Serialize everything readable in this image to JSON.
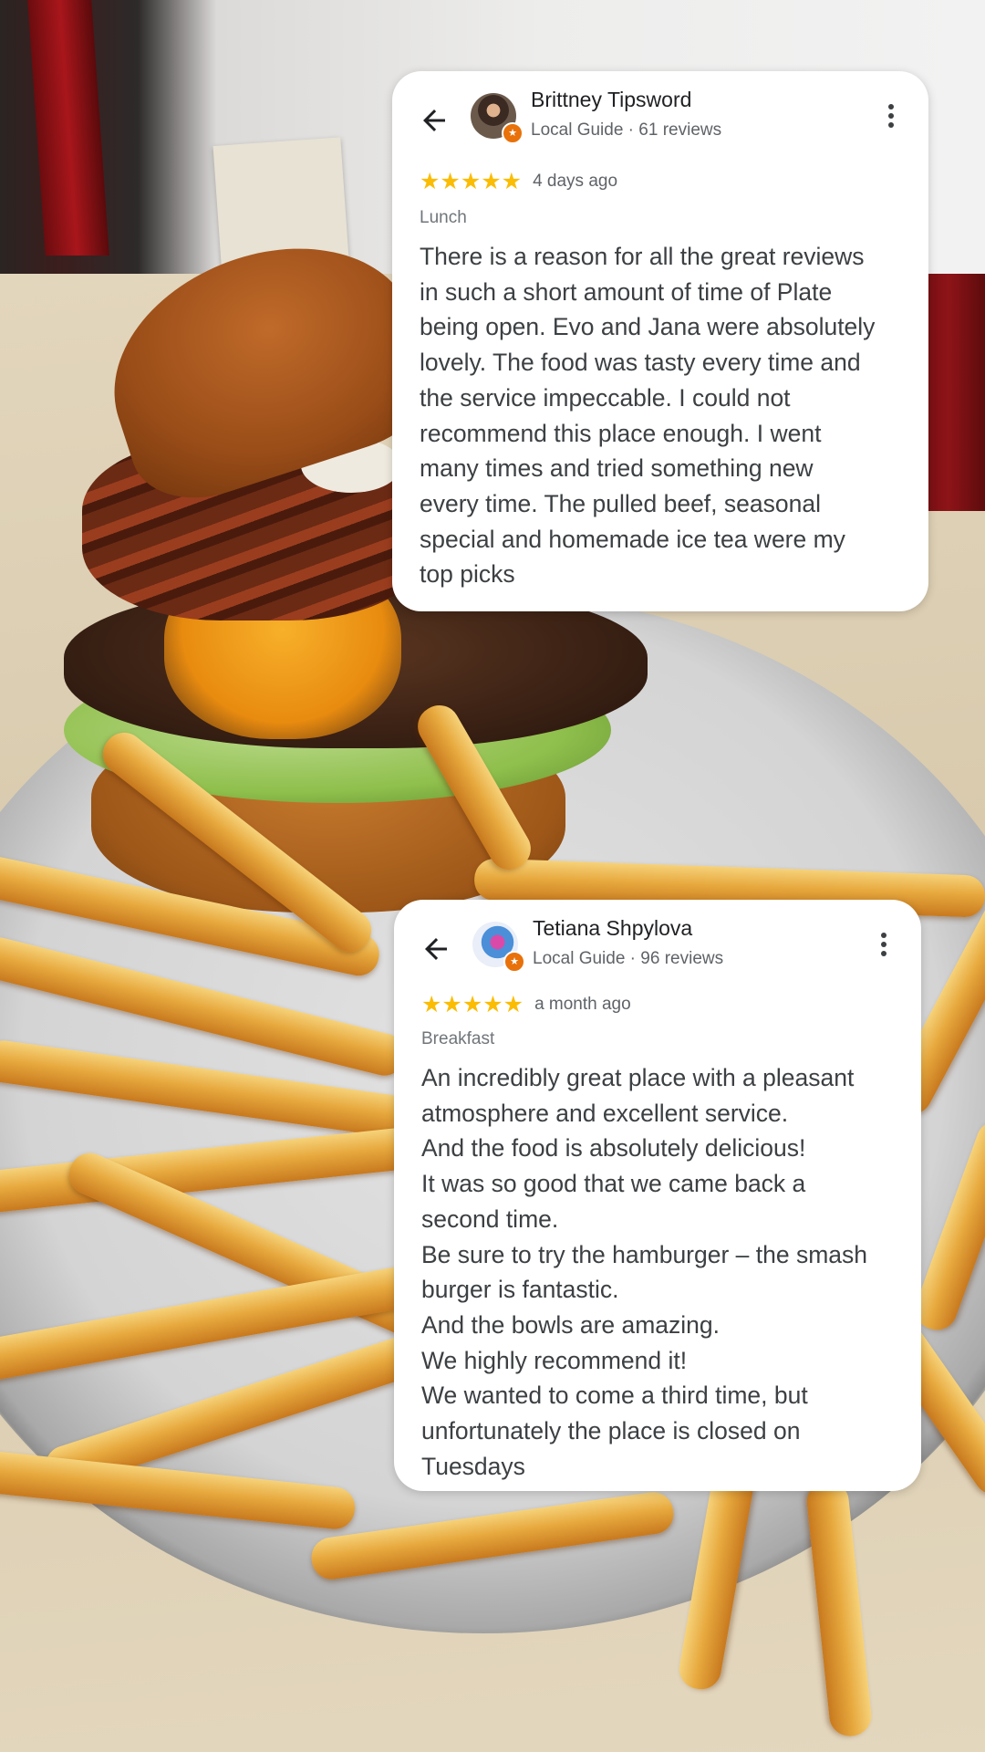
{
  "reviews": [
    {
      "name": "Brittney Tipsword",
      "meta": "Local Guide · 61 reviews",
      "stars": "★★★★★",
      "rating": 5,
      "time": "4 days ago",
      "meal": "Lunch",
      "text_lines": [
        "There is a reason for all the great reviews",
        "in such a short amount of time of Plate",
        "being open. Evo and Jana were absolutely",
        "lovely. The food was tasty every time and",
        "the service impeccable. I could not",
        "recommend this place enough. I went",
        "many times and tried something new",
        "every time. The pulled beef, seasonal",
        "special and homemade ice tea were my",
        "top picks"
      ]
    },
    {
      "name": "Tetiana Shpylova",
      "meta": "Local Guide · 96 reviews",
      "stars": "★★★★★",
      "rating": 5,
      "time": "a month ago",
      "meal": "Breakfast",
      "text_lines": [
        "An incredibly great place with a pleasant",
        "atmosphere and excellent service.",
        "And the food is absolutely delicious!",
        "It was so good that we came back a",
        "second time.",
        "Be sure to try the hamburger – the smash",
        "burger is fantastic.",
        "And the bowls are amazing.",
        "We highly recommend it!",
        "We wanted to come a third time, but",
        "unfortunately the place is closed on",
        "Tuesdays"
      ]
    }
  ],
  "icons": {
    "back": "arrow-back-icon",
    "more": "more-vert-icon",
    "badge": "local-guide-star-icon"
  },
  "colors": {
    "star": "#fbbc04",
    "badge": "#e8710a",
    "card": "#ffffff",
    "text": "#3c4043"
  }
}
